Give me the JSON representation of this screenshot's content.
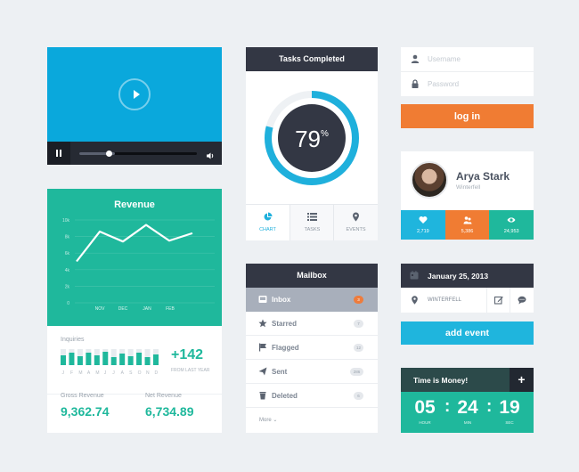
{
  "video": {
    "progress": 0.25,
    "buffered": 0.3
  },
  "revenue": {
    "title": "Revenue",
    "inquiries_label": "Inquiries",
    "inquiries_value": "+142",
    "inquiries_sub": "FROM LAST YEAR",
    "months_short": [
      "J",
      "F",
      "M",
      "A",
      "M",
      "J",
      "J",
      "A",
      "S",
      "O",
      "N",
      "D"
    ],
    "gross_label": "Gross Revenue",
    "gross_value": "9,362.74",
    "net_label": "Net Revenue",
    "net_value": "6,734.89"
  },
  "chart_data": {
    "type": "line",
    "title": "Revenue",
    "y_ticks": [
      "10k",
      "8k",
      "6k",
      "4k",
      "2k",
      "0"
    ],
    "ylim": [
      0,
      10
    ],
    "x_labels": [
      "NOV",
      "DEC",
      "JAN",
      "FEB"
    ],
    "x": [
      0,
      1,
      2,
      3,
      4,
      5
    ],
    "values": [
      5.0,
      8.6,
      7.4,
      9.4,
      7.5,
      8.4
    ],
    "grid": true,
    "color": "#ffffff"
  },
  "inquiries_chart": {
    "type": "bar",
    "values": [
      0.55,
      0.7,
      0.5,
      0.7,
      0.55,
      0.75,
      0.45,
      0.65,
      0.5,
      0.7,
      0.45,
      0.6
    ],
    "background": [
      0.9,
      0.9,
      0.9,
      0.9,
      0.9,
      0.9,
      0.9,
      0.9,
      0.9,
      0.9,
      0.9,
      0.9
    ]
  },
  "tasks": {
    "title": "Tasks Completed",
    "percent": 79,
    "percent_text": "79",
    "percent_sign": "%",
    "tabs": [
      {
        "label": "CHART",
        "icon": "pie-chart-icon",
        "active": true
      },
      {
        "label": "TASKS",
        "icon": "list-icon",
        "active": false
      },
      {
        "label": "EVENTS",
        "icon": "pin-icon",
        "active": false
      }
    ]
  },
  "mailbox": {
    "title": "Mailbox",
    "items": [
      {
        "label": "Inbox",
        "count": "3",
        "icon": "inbox-icon",
        "selected": true
      },
      {
        "label": "Starred",
        "count": "7",
        "icon": "star-icon",
        "selected": false
      },
      {
        "label": "Flagged",
        "count": "12",
        "icon": "flag-icon",
        "selected": false
      },
      {
        "label": "Sent",
        "count": "286",
        "icon": "send-icon",
        "selected": false
      },
      {
        "label": "Deleted",
        "count": "6",
        "icon": "trash-icon",
        "selected": false
      }
    ],
    "more": "More ⌄"
  },
  "login": {
    "username_placeholder": "Username",
    "password_placeholder": "Password",
    "button": "log in"
  },
  "profile": {
    "name": "Arya Stark",
    "location": "Winterfell",
    "stats": [
      {
        "value": "2,719",
        "icon": "heart-icon",
        "color": "#1fb5dd"
      },
      {
        "value": "5,386",
        "icon": "users-icon",
        "color": "#f07c33"
      },
      {
        "value": "24,953",
        "icon": "eye-icon",
        "color": "#1fb89c"
      }
    ]
  },
  "calendar": {
    "date": "January 25, 2013",
    "location": "WINTERFELL",
    "button": "add event"
  },
  "timer": {
    "title": "Time is Money!",
    "plus": "+",
    "hour": "05",
    "min": "24",
    "sec": "19",
    "colon": ":",
    "hour_label": "HOUR",
    "min_label": "MIN",
    "sec_label": "SEC"
  }
}
